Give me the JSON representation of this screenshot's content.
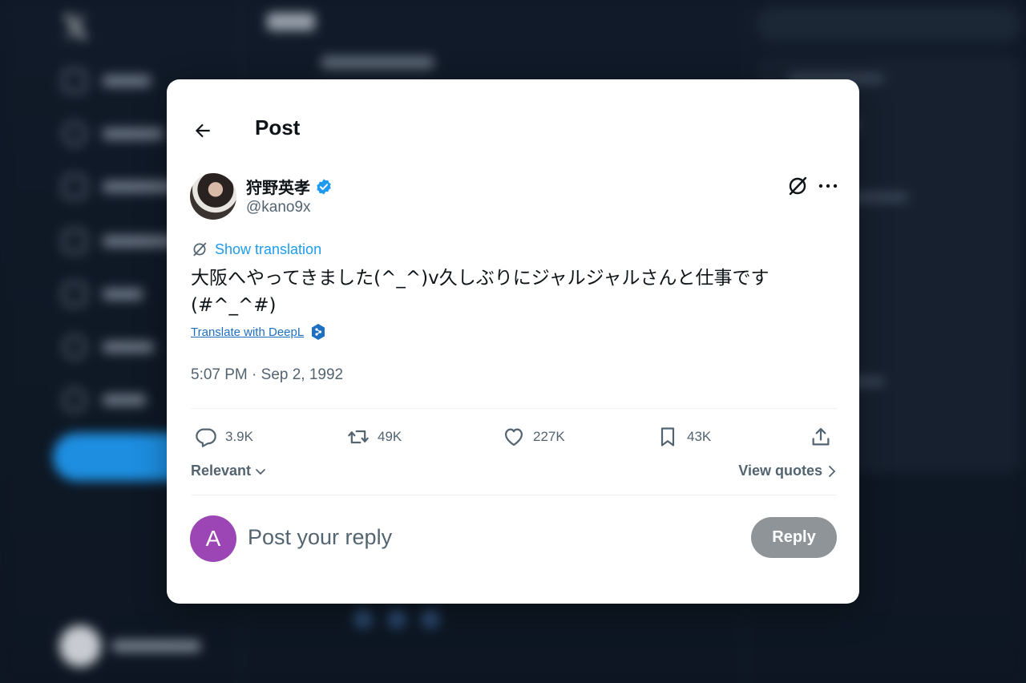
{
  "background": {
    "note_blurred": true
  },
  "header": {
    "title": "Post"
  },
  "tweet": {
    "author_name": "狩野英孝",
    "handle": "@kano9x",
    "verified": true,
    "show_translation": "Show translation",
    "text_line1": "大阪へやってきました(^_^)v久しぶりにジャルジャルさんと仕事です",
    "text_line2": "(#^_^#)",
    "deepl": "Translate with DeepL",
    "timestamp": "5:07 PM · Sep 2, 1992"
  },
  "actions": {
    "replies": "3.9K",
    "reposts": "49K",
    "likes": "227K",
    "bookmarks": "43K"
  },
  "sort": {
    "label": "Relevant",
    "view_quotes": "View quotes"
  },
  "reply": {
    "avatar_letter": "A",
    "placeholder": "Post your reply",
    "button": "Reply"
  },
  "colors": {
    "accent": "#1d9bf0",
    "reply_avatar": "#9c45b5",
    "reply_button_disabled": "#8f9498"
  }
}
